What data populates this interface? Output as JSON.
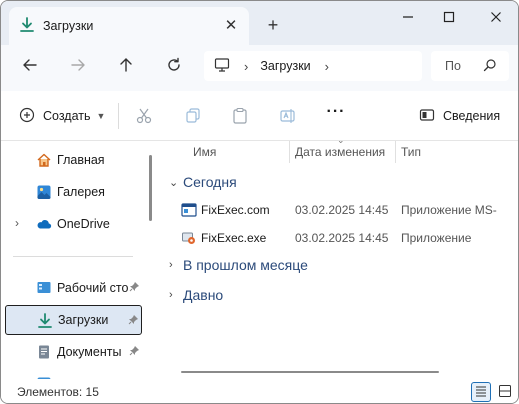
{
  "window": {
    "tab_title": "Загрузки",
    "new_tab": "+",
    "close_tab": "✕"
  },
  "nav": {
    "breadcrumb": "Загрузки",
    "search_placeholder": "По"
  },
  "toolbar": {
    "create_label": "Создать",
    "more_label": "···",
    "details_label": "Сведения"
  },
  "sidebar": {
    "items": [
      {
        "label": "Главная"
      },
      {
        "label": "Галерея"
      },
      {
        "label": "OneDrive"
      },
      {
        "label": "Рабочий сто"
      },
      {
        "label": "Загрузки"
      },
      {
        "label": "Документы"
      }
    ]
  },
  "columns": {
    "name": "Имя",
    "date": "Дата изменения",
    "type": "Тип"
  },
  "groups": {
    "today": "Сегодня",
    "last_month": "В прошлом месяце",
    "long_ago": "Давно"
  },
  "files": [
    {
      "name": "FixExec.com",
      "date": "03.02.2025 14:45",
      "type": "Приложение MS-"
    },
    {
      "name": "FixExec.exe",
      "date": "03.02.2025 14:45",
      "type": "Приложение"
    }
  ],
  "status": {
    "count": "Элементов: 15"
  },
  "colors": {
    "accent": "#1f8a70",
    "selection": "#dde7f3",
    "group_text": "#2b4a7a"
  }
}
